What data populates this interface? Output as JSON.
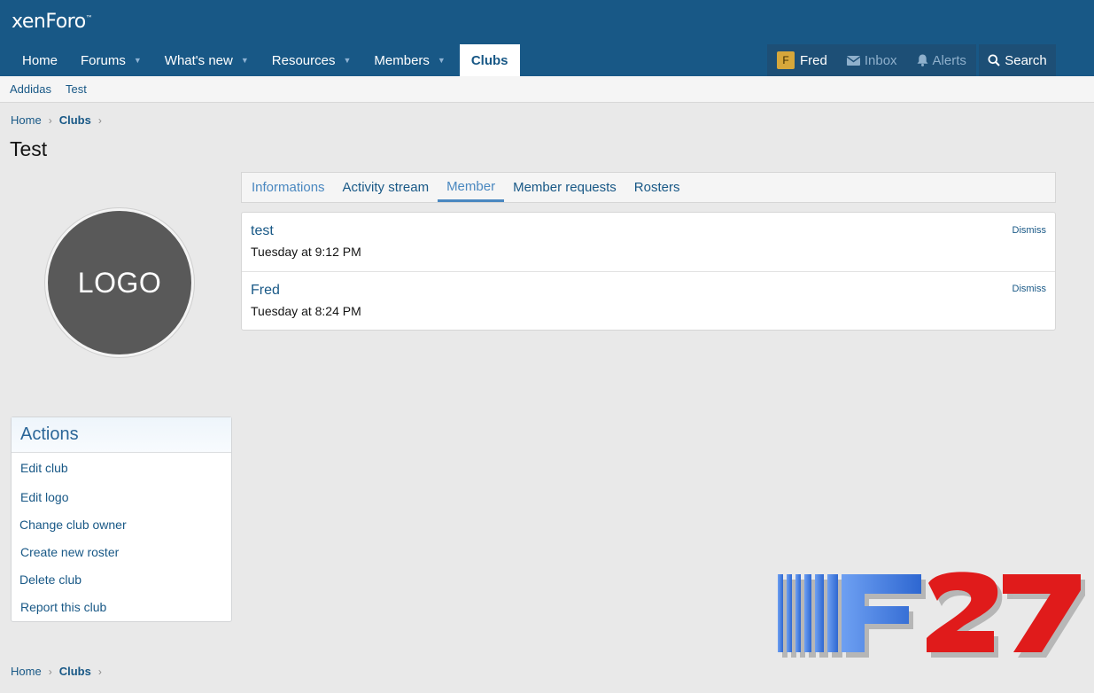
{
  "header": {
    "logo_text": "xenForo",
    "logo_mark": "™",
    "nav": [
      {
        "label": "Home",
        "caret": false
      },
      {
        "label": "Forums",
        "caret": true
      },
      {
        "label": "What's new",
        "caret": true
      },
      {
        "label": "Resources",
        "caret": true
      },
      {
        "label": "Members",
        "caret": true
      },
      {
        "label": "Clubs",
        "caret": false,
        "active": true
      }
    ],
    "user": {
      "initial": "F",
      "name": "Fred"
    },
    "inbox_label": "Inbox",
    "alerts_label": "Alerts",
    "search_label": "Search"
  },
  "subnav": {
    "items": [
      "Addidas",
      "Test"
    ]
  },
  "breadcrumb": {
    "home": "Home",
    "clubs": "Clubs",
    "sep": "›"
  },
  "page": {
    "title": "Test"
  },
  "club": {
    "logo_text": "LOGO"
  },
  "tabs": [
    {
      "label": "Informations"
    },
    {
      "label": "Activity stream"
    },
    {
      "label": "Member",
      "selected": true
    },
    {
      "label": "Member requests"
    },
    {
      "label": "Rosters"
    }
  ],
  "members": [
    {
      "name": "test",
      "time": "Tuesday at 9:12 PM",
      "dismiss": "Dismiss"
    },
    {
      "name": "Fred",
      "time": "Tuesday at 8:24 PM",
      "dismiss": "Dismiss"
    }
  ],
  "actions": {
    "title": "Actions",
    "items": [
      "Edit club",
      "Edit logo",
      "Change club owner",
      "Create new roster",
      "Delete club",
      "Report this club"
    ]
  },
  "watermark": {
    "text": "F27",
    "colors": {
      "bars": "#3d7be0",
      "number": "#e01b1b"
    }
  },
  "colors": {
    "header": "#185886",
    "link": "#185886",
    "accent": "#4a88c0"
  }
}
